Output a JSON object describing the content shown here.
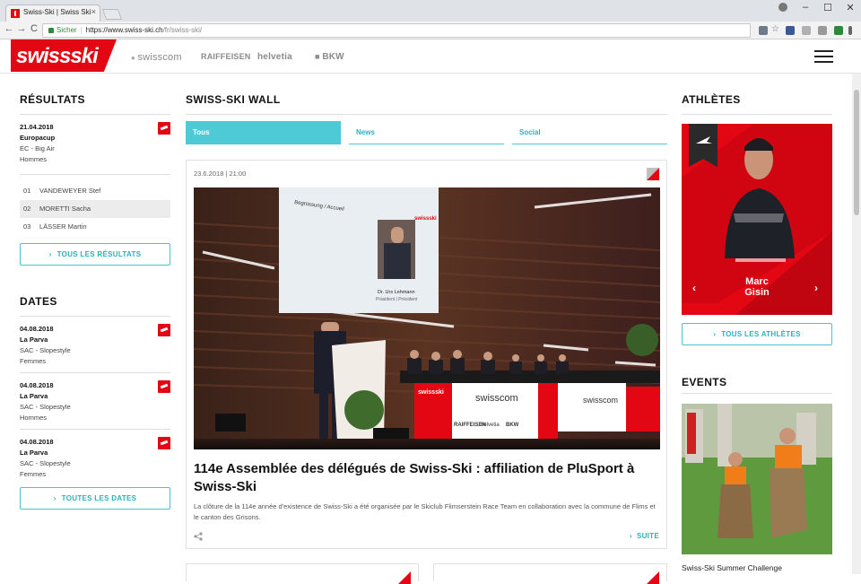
{
  "browser": {
    "tab_title": "Swiss-Ski | Swiss Ski",
    "tab_close": "×",
    "secure_label": "Sicher",
    "url_host": "https://www.swiss-ski.ch",
    "url_path": "/fr/swiss-ski/",
    "win_min": "–",
    "win_max": "☐",
    "win_close": "✕",
    "back": "←",
    "forward": "→",
    "reload": "C",
    "star": "☆"
  },
  "header": {
    "logo_a": "swiss",
    "logo_b": "ski",
    "sponsors": [
      "swisscom",
      "RAIFFEISEN",
      "helvetia",
      "BKW"
    ]
  },
  "results": {
    "title": "RÉSULTATS",
    "date": "21.04.2018",
    "event": "Europacup",
    "place": "EC - Big Air",
    "category": "Hommes",
    "rows": [
      {
        "rank": "01",
        "name": "VANDEWEYER Stef"
      },
      {
        "rank": "02",
        "name": "MORETTI Sacha"
      },
      {
        "rank": "03",
        "name": "LÄSSER Martin"
      }
    ],
    "button": "TOUS LES RÉSULTATS",
    "chevron": "›"
  },
  "dates": {
    "title": "DATES",
    "items": [
      {
        "date": "04.08.2018",
        "place": "La Parva",
        "discipline": "SAC - Slopestyle",
        "category": "Femmes"
      },
      {
        "date": "04.08.2018",
        "place": "La Parva",
        "discipline": "SAC - Slopestyle",
        "category": "Hommes"
      },
      {
        "date": "04.08.2018",
        "place": "La Parva",
        "discipline": "SAC - Slopestyle",
        "category": "Femmes"
      }
    ],
    "button": "TOUTES LES DATES"
  },
  "wall": {
    "title": "SWISS-SKI WALL",
    "filters": [
      "Tous",
      "News",
      "Social"
    ],
    "card": {
      "date": "23.6.2018 | 21:00",
      "title": "114e Assemblée des délégués de Swiss-Ski : affiliation de PluSport à Swiss-Ski",
      "text": "La clôture de la 114e année d'existence de Swiss-Ski a été organisée par le Skiclub Flimserstein Race Team en collaboration avec la commune de Flims et le canton des Grisons.",
      "more": "SUITE",
      "slide_heading": "Begrüssung / Accueil",
      "slide_caption": "Dr. Urs Lehmann",
      "slide_role": "Präsident | Président",
      "table_banner_1": "swisscom",
      "table_banner_2": "RAIFFEISEN",
      "table_banner_3": "helvetia",
      "table_banner_4": "BKW",
      "table_logo": "swissski"
    }
  },
  "athletes": {
    "title": "ATHLÈTES",
    "first_name": "Marc",
    "last_name": "Gisin",
    "prev": "‹",
    "next": "›",
    "button": "TOUS LES ATHLÈTES"
  },
  "events": {
    "title": "EVENTS",
    "caption": "Swiss-Ski Summer Challenge"
  }
}
